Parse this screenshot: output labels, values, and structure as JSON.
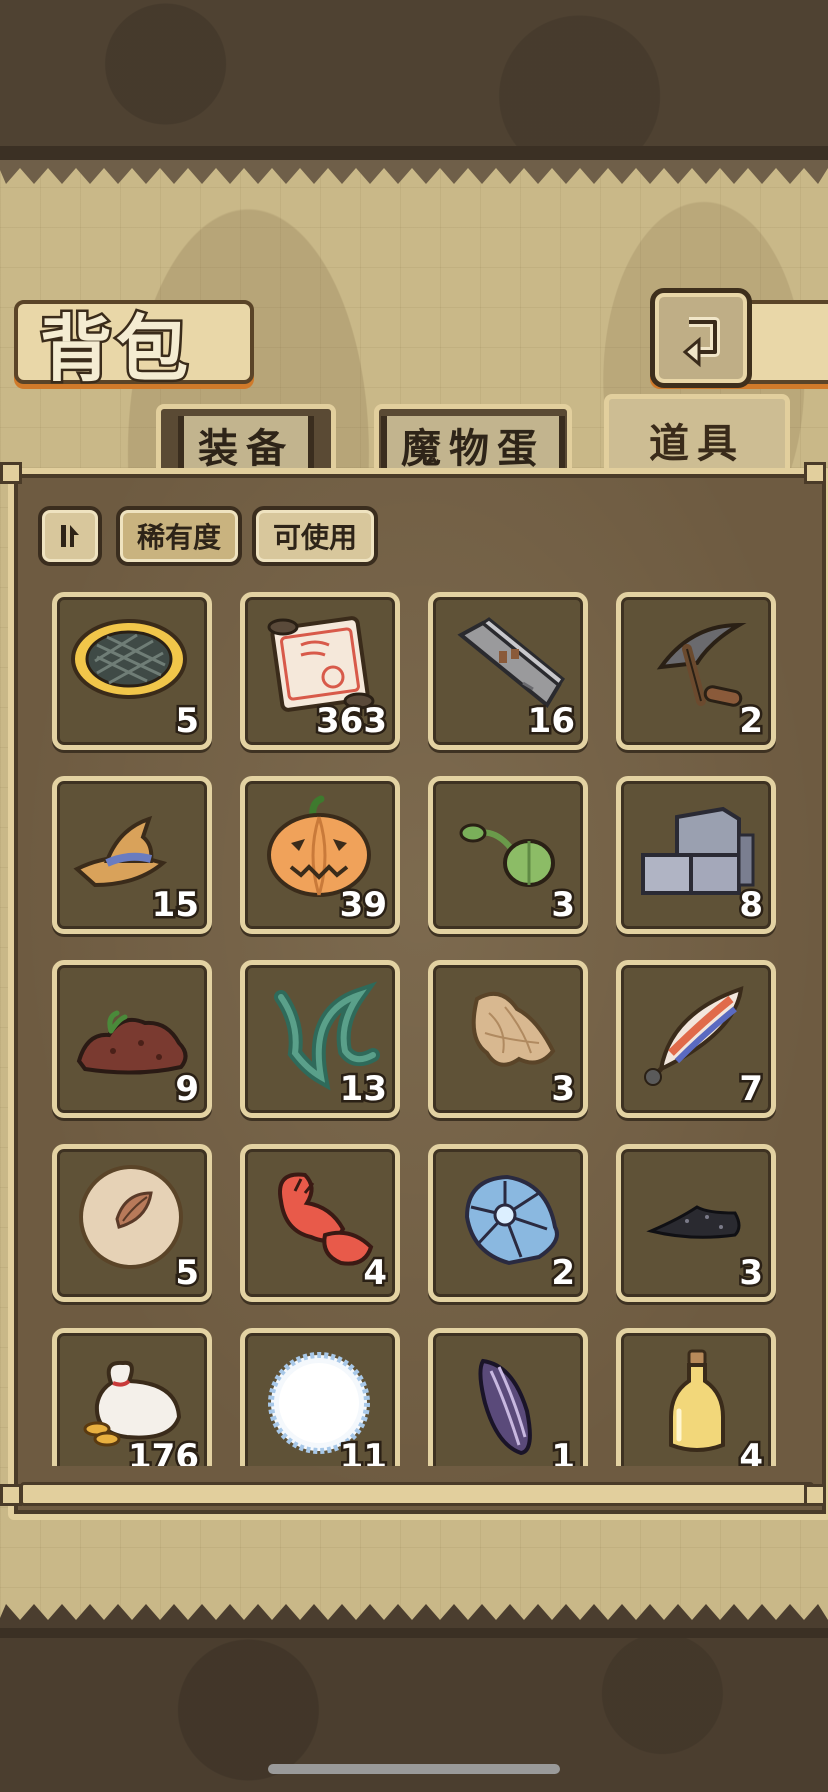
{
  "header": {
    "title": "背包"
  },
  "tabs": [
    {
      "label": "装备",
      "active": false
    },
    {
      "label": "魔物蛋",
      "active": false
    },
    {
      "label": "道具",
      "active": true
    }
  ],
  "filters": {
    "rarity_label": "稀有度",
    "usable_label": "可使用",
    "active": "稀有度"
  },
  "items": [
    {
      "icon": "woven-mat-icon",
      "count": "5"
    },
    {
      "icon": "scroll-icon",
      "count": "363"
    },
    {
      "icon": "stone-slab-icon",
      "count": "16"
    },
    {
      "icon": "pickaxe-icon",
      "count": "2"
    },
    {
      "icon": "witch-hat-icon",
      "count": "15"
    },
    {
      "icon": "pumpkin-icon",
      "count": "39"
    },
    {
      "icon": "green-seed-icon",
      "count": "3"
    },
    {
      "icon": "stone-blocks-icon",
      "count": "8"
    },
    {
      "icon": "soil-pile-icon",
      "count": "9"
    },
    {
      "icon": "seaweed-icon",
      "count": "13"
    },
    {
      "icon": "fiber-clump-icon",
      "count": "3"
    },
    {
      "icon": "feather-icon",
      "count": "7"
    },
    {
      "icon": "seed-orb-icon",
      "count": "5"
    },
    {
      "icon": "crab-claw-icon",
      "count": "4"
    },
    {
      "icon": "blue-shell-icon",
      "count": "2"
    },
    {
      "icon": "coal-icon",
      "count": "3"
    },
    {
      "icon": "coin-bag-icon",
      "count": "176"
    },
    {
      "icon": "cotton-ball-icon",
      "count": "11"
    },
    {
      "icon": "sunflower-seed-icon",
      "count": "1"
    },
    {
      "icon": "potion-bottle-icon",
      "count": "4"
    }
  ],
  "colors": {
    "panel": "#6e5b41",
    "frame": "#e2cf9d",
    "accent_orange": "#d07a2a"
  }
}
